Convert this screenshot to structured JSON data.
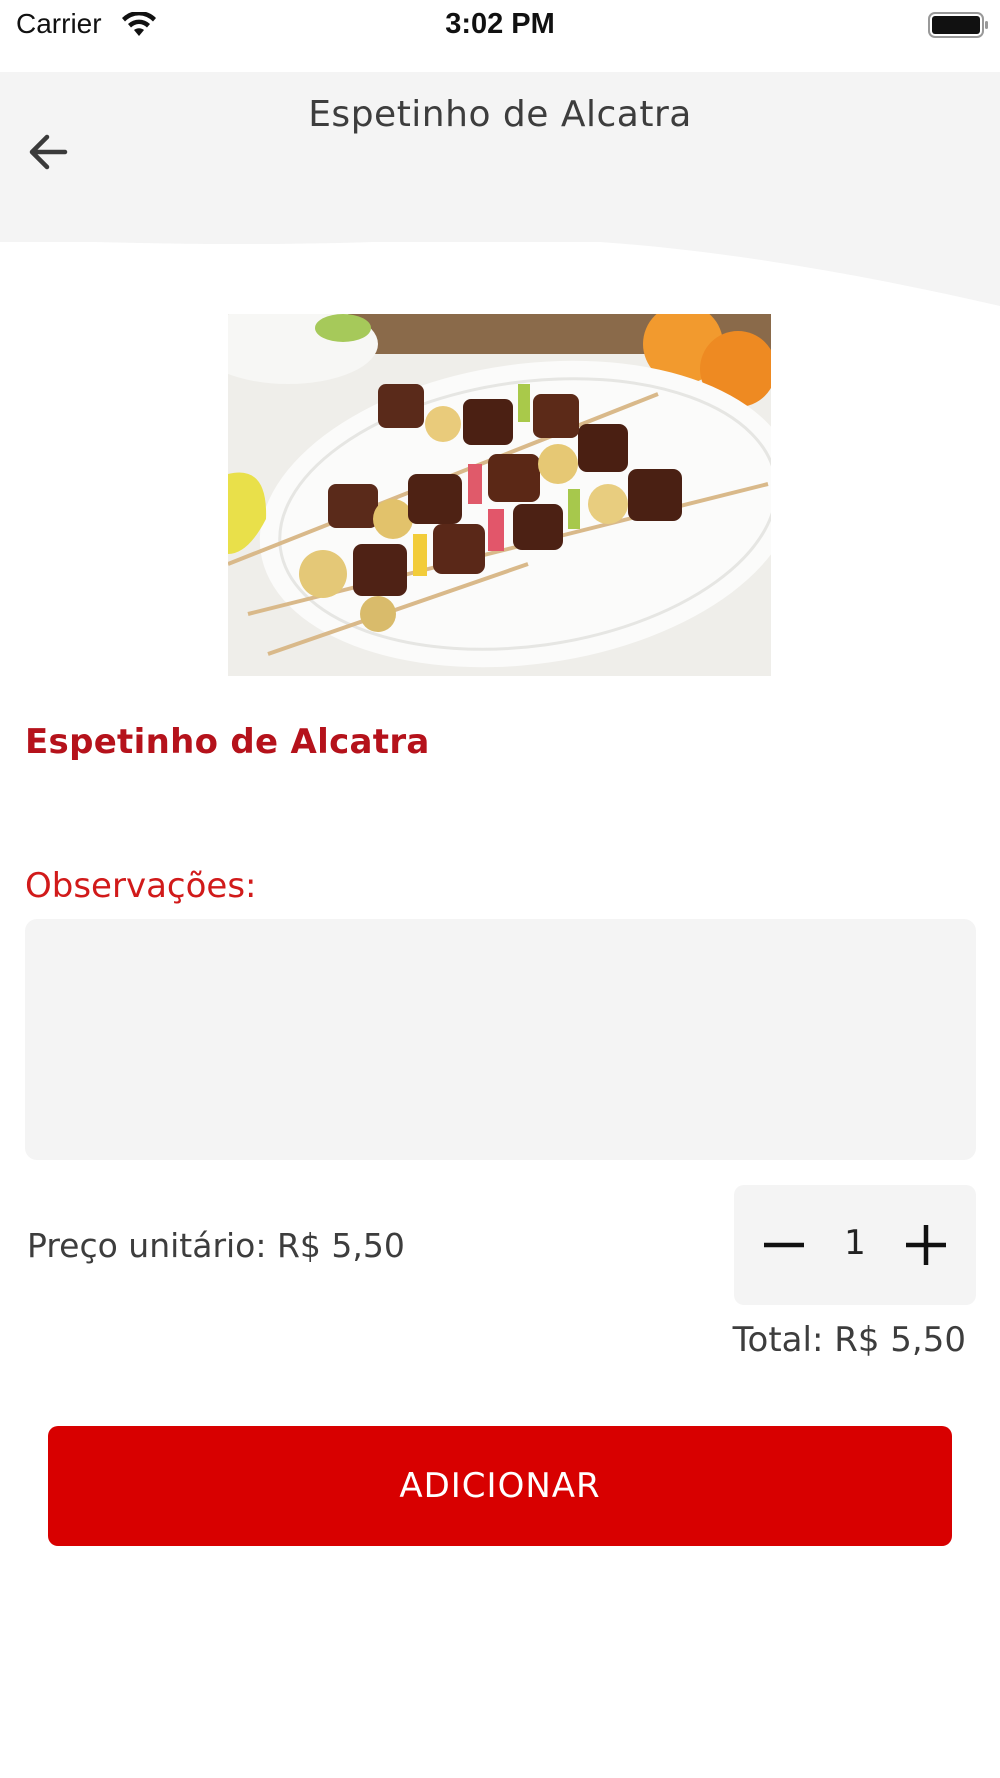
{
  "status_bar": {
    "carrier": "Carrier",
    "time": "3:02 PM",
    "wifi_icon": "wifi-icon",
    "battery_icon": "battery-icon"
  },
  "header": {
    "title": "Espetinho de Alcatra",
    "back_icon": "arrow-left-icon",
    "background_color": "#f4f4f4"
  },
  "product": {
    "image": "skewers-photo",
    "name": "Espetinho de Alcatra"
  },
  "observations": {
    "label": "Observações:",
    "value": "",
    "placeholder": ""
  },
  "pricing": {
    "unit_price_label": "Preço unitário: R$ 5,50",
    "quantity": "1",
    "minus_icon": "minus-icon",
    "plus_icon": "plus-icon",
    "total_label": "Total: R$ 5,50"
  },
  "actions": {
    "add_label": "ADICIONAR"
  },
  "colors": {
    "accent_red": "#d80000",
    "title_red": "#b5121b",
    "label_red": "#d11a1a",
    "field_gray": "#f4f4f4"
  }
}
